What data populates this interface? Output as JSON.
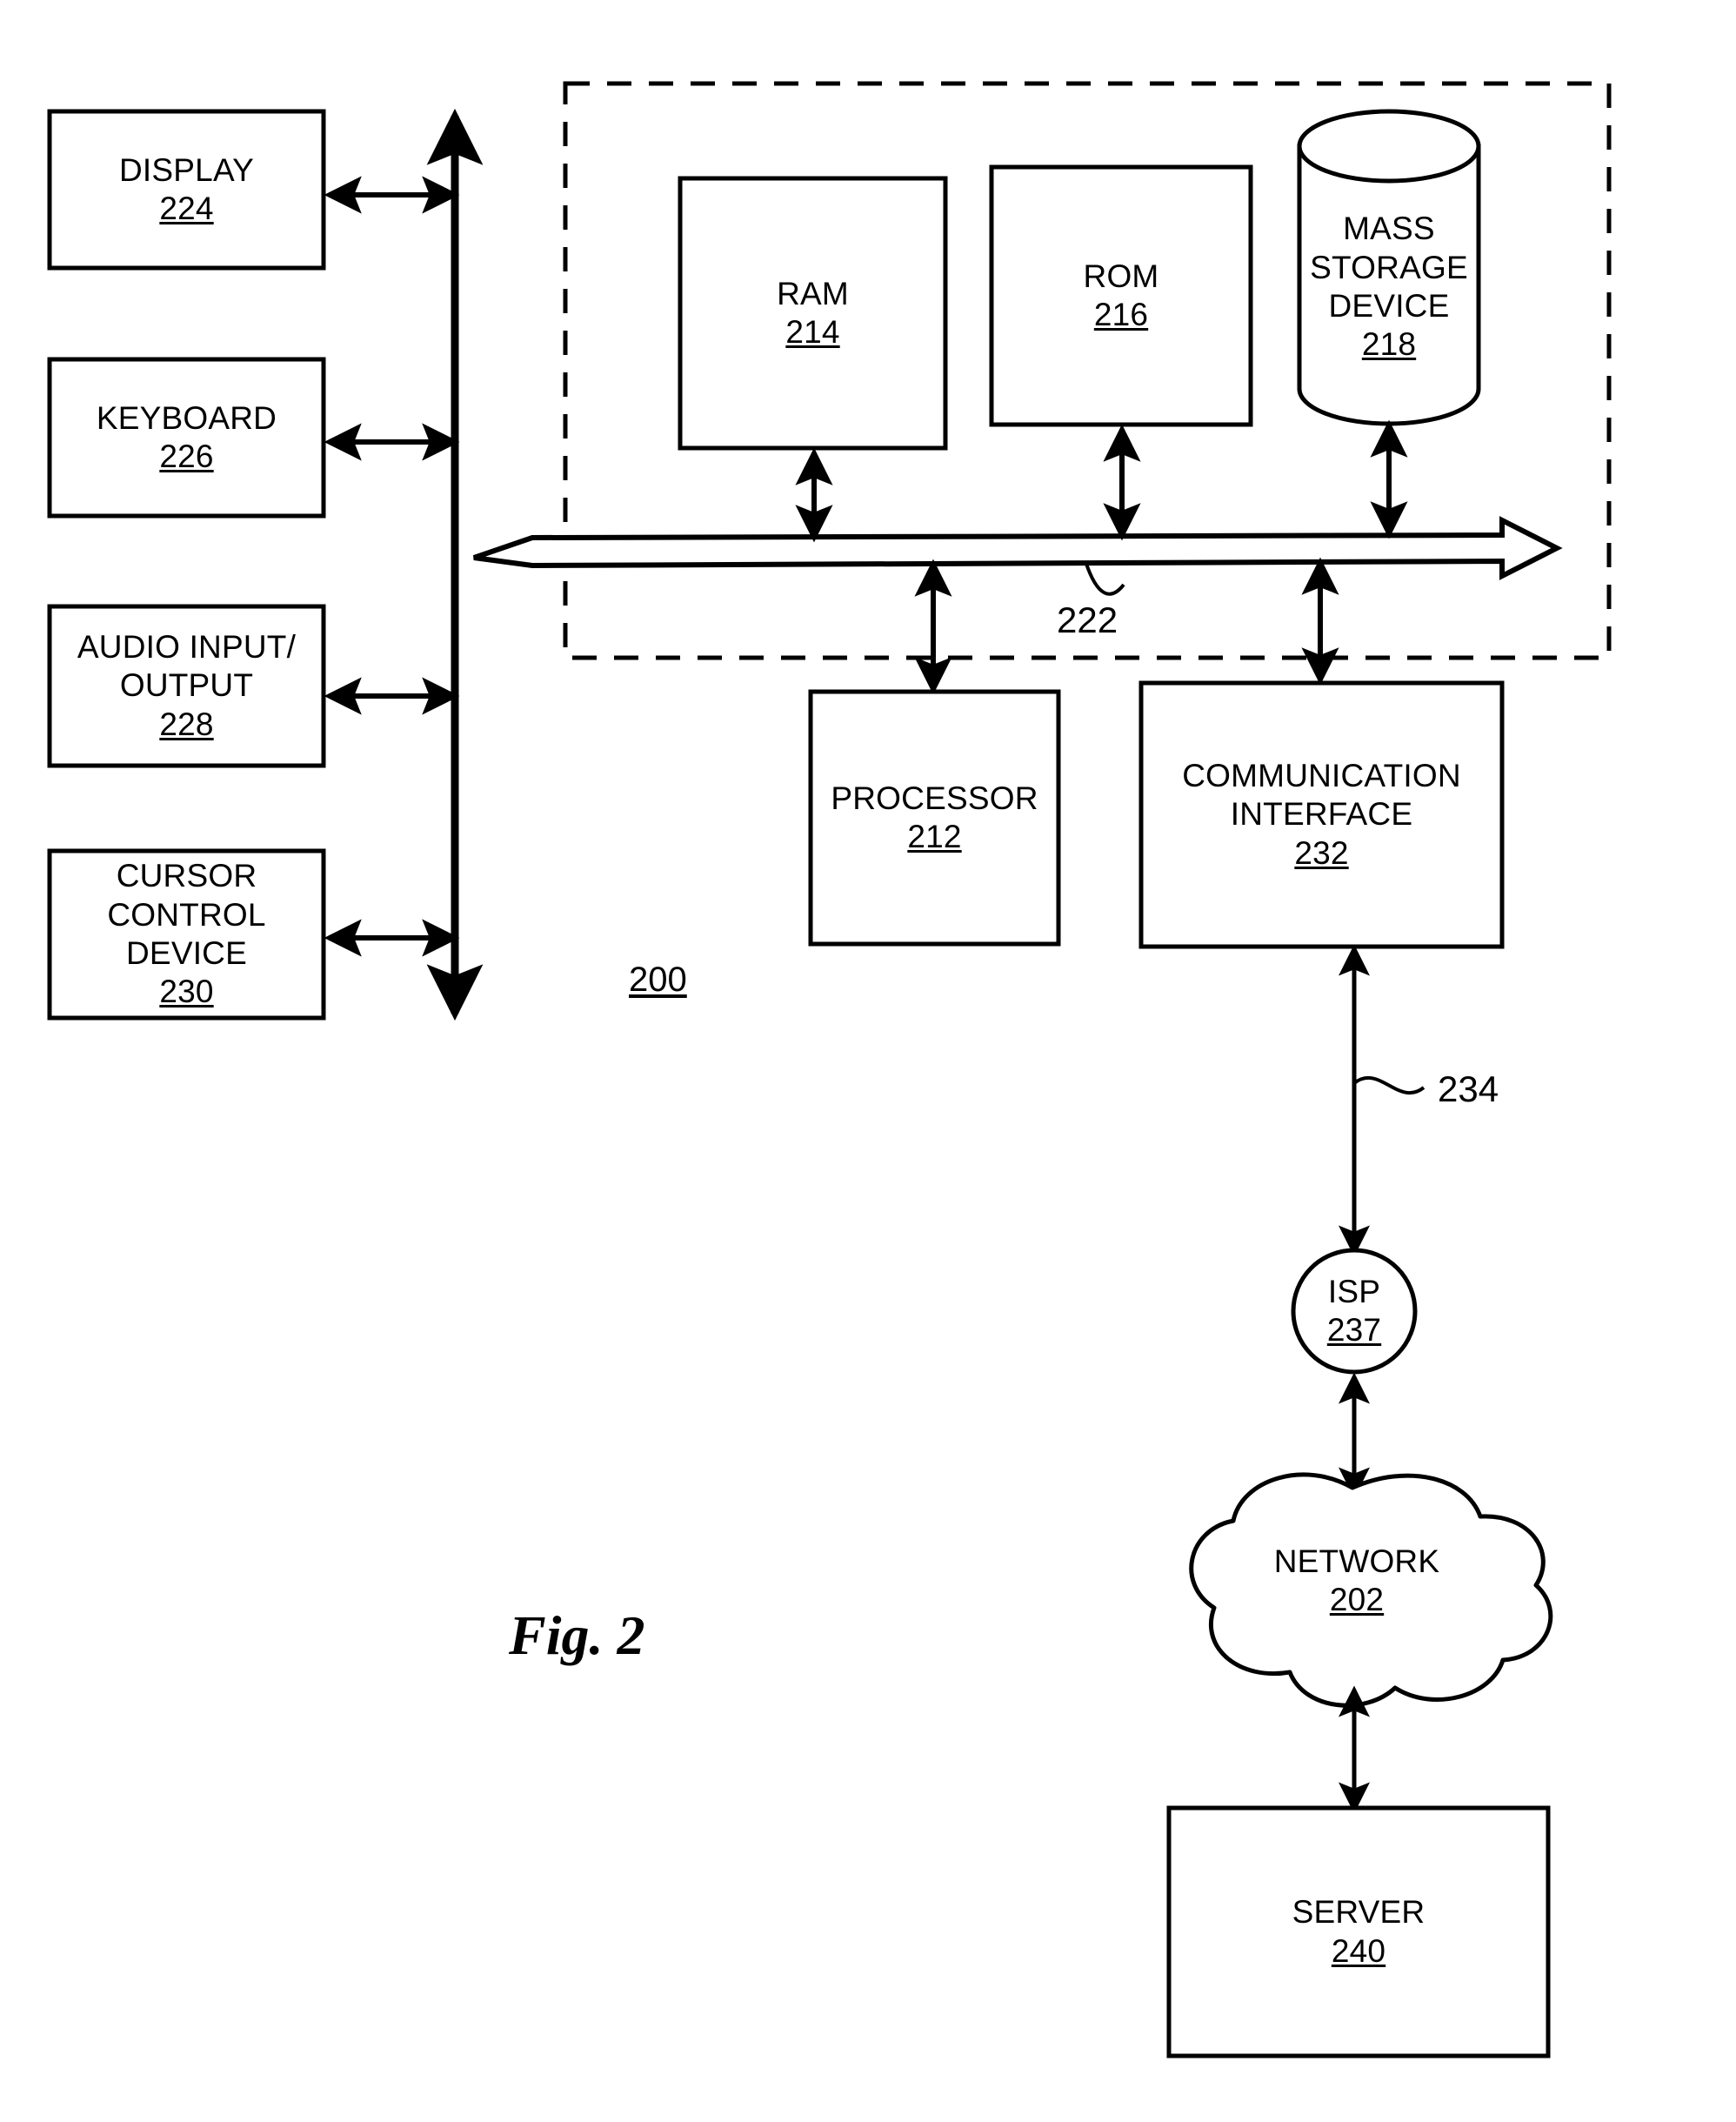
{
  "figure": {
    "caption": "Fig. 2",
    "system_ref": "200"
  },
  "peripherals": [
    {
      "name": "display",
      "title": "DISPLAY",
      "ref": "224"
    },
    {
      "name": "keyboard",
      "title": "KEYBOARD",
      "ref": "226"
    },
    {
      "name": "audio-io",
      "title": "AUDIO INPUT/\nOUTPUT",
      "ref": "228"
    },
    {
      "name": "cursor-control",
      "title": "CURSOR\nCONTROL\nDEVICE",
      "ref": "230"
    }
  ],
  "internal_components": [
    {
      "name": "ram",
      "title": "RAM",
      "ref": "214"
    },
    {
      "name": "rom",
      "title": "ROM",
      "ref": "216"
    },
    {
      "name": "mass-storage-device",
      "title": "MASS\nSTORAGE\nDEVICE",
      "ref": "218"
    },
    {
      "name": "processor",
      "title": "PROCESSOR",
      "ref": "212"
    },
    {
      "name": "communication-interface",
      "title": "COMMUNICATION\nINTERFACE",
      "ref": "232"
    }
  ],
  "bus": {
    "label": "222"
  },
  "external_link": {
    "label": "234"
  },
  "network_chain": [
    {
      "name": "isp",
      "title": "ISP",
      "ref": "237"
    },
    {
      "name": "network",
      "title": "NETWORK",
      "ref": "202"
    },
    {
      "name": "server",
      "title": "SERVER",
      "ref": "240"
    }
  ],
  "labels": {
    "display_title": "DISPLAY",
    "display_ref": "224",
    "keyboard_title": "KEYBOARD",
    "keyboard_ref": "226",
    "audio_title_line1": "AUDIO INPUT/",
    "audio_title_line2": "OUTPUT",
    "audio_ref": "228",
    "cursor_title_line1": "CURSOR",
    "cursor_title_line2": "CONTROL",
    "cursor_title_line3": "DEVICE",
    "cursor_ref": "230",
    "ram_title": "RAM",
    "ram_ref": "214",
    "rom_title": "ROM",
    "rom_ref": "216",
    "mass_title_line1": "MASS",
    "mass_title_line2": "STORAGE",
    "mass_title_line3": "DEVICE",
    "mass_ref": "218",
    "processor_title": "PROCESSOR",
    "processor_ref": "212",
    "comm_title_line1": "COMMUNICATION",
    "comm_title_line2": "INTERFACE",
    "comm_ref": "232",
    "bus_ref": "222",
    "system_ref": "200",
    "link_ref": "234",
    "isp_title": "ISP",
    "isp_ref": "237",
    "network_title": "NETWORK",
    "network_ref": "202",
    "server_title": "SERVER",
    "server_ref": "240",
    "figure_caption": "Fig. 2"
  },
  "colors": {
    "ink": "#000000",
    "paper": "#ffffff"
  }
}
